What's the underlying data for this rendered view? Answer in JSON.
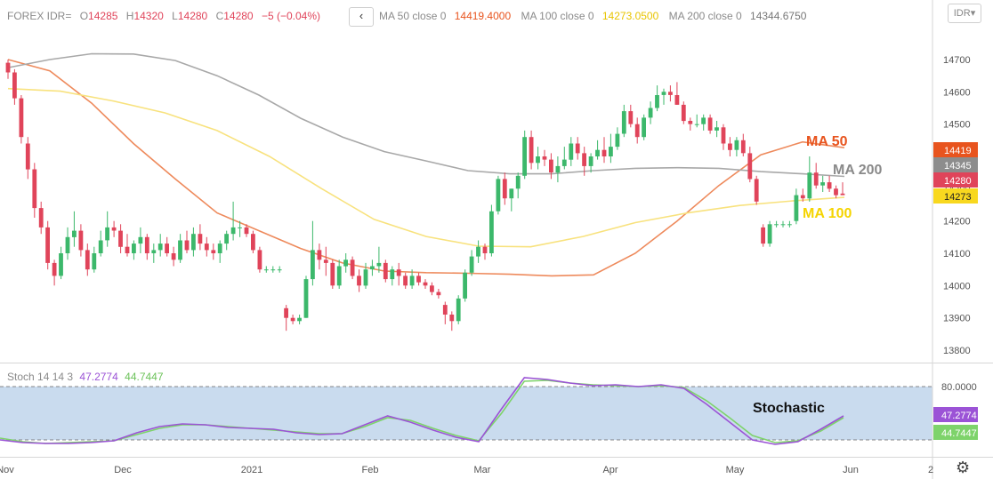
{
  "header": {
    "symbol": "FOREX IDR=",
    "o_label": "O",
    "o_value": "14285",
    "h_label": "H",
    "h_value": "14320",
    "l_label": "L",
    "l_value": "14280",
    "c_label": "C",
    "c_value": "14280",
    "change": "−5 (−0.04%)",
    "collapse_glyph": "‹",
    "ma50_label": "MA 50 close 0",
    "ma50_value": "14419.4000",
    "ma100_label": "MA 100 close 0",
    "ma100_value": "14273.0500",
    "ma200_label": "MA 200 close 0",
    "ma200_value": "14344.6750",
    "currency_button": "IDR"
  },
  "stoch_header": {
    "label": "Stoch 14 14 3",
    "k_value": "47.2774",
    "d_value": "44.7447"
  },
  "colors": {
    "up": "#3cb86b",
    "down": "#e0445a",
    "ma50": "#ee8a5c",
    "ma100": "#f8e27e",
    "ma200": "#a8a8a8",
    "stoch_k": "#9b53d6",
    "stoch_d": "#7ed36b",
    "stoch_band": "#c9dbee",
    "ma50_text": "#e8541e",
    "ma100_text": "#f5d400",
    "ma200_text": "#8a8a8a"
  },
  "icons": {
    "settings": "gear-icon",
    "collapse": "chevron-left-icon"
  },
  "chart_data": [
    {
      "type": "candlestick",
      "title": "FOREX IDR=",
      "y_ticks": [
        "14700",
        "14600",
        "14500",
        "14400",
        "14300",
        "14200",
        "14100",
        "14000",
        "13900",
        "13800"
      ],
      "x_ticks": [
        "Nov",
        "Dec",
        "2021",
        "Feb",
        "Mar",
        "Apr",
        "May",
        "Jun",
        "2"
      ],
      "ylim": [
        13760,
        14830
      ],
      "grid": false,
      "price_labels": [
        {
          "text": "14419",
          "value": 14419,
          "series": "MA 50"
        },
        {
          "text": "14345",
          "value": 14345,
          "series": "MA 200"
        },
        {
          "text": "14280",
          "value": 14280,
          "series": "Price"
        },
        {
          "text": "14273",
          "value": 14273,
          "series": "MA 100"
        }
      ],
      "annotations": [
        {
          "text": "MA 50",
          "series": "ma50"
        },
        {
          "text": "MA 200",
          "series": "ma200"
        },
        {
          "text": "MA 100",
          "series": "ma100"
        }
      ],
      "candles": [
        [
          14690,
          14700,
          14640,
          14660
        ],
        [
          14660,
          14670,
          14560,
          14580
        ],
        [
          14580,
          14590,
          14440,
          14460
        ],
        [
          14440,
          14460,
          14330,
          14360
        ],
        [
          14360,
          14380,
          14210,
          14240
        ],
        [
          14240,
          14260,
          14160,
          14180
        ],
        [
          14180,
          14200,
          14050,
          14070
        ],
        [
          14070,
          14080,
          14000,
          14030
        ],
        [
          14030,
          14120,
          14020,
          14100
        ],
        [
          14100,
          14180,
          14080,
          14150
        ],
        [
          14150,
          14230,
          14120,
          14170
        ],
        [
          14170,
          14190,
          14090,
          14110
        ],
        [
          14110,
          14130,
          14030,
          14050
        ],
        [
          14050,
          14120,
          14040,
          14100
        ],
        [
          14100,
          14170,
          14090,
          14140
        ],
        [
          14140,
          14230,
          14120,
          14180
        ],
        [
          14180,
          14200,
          14150,
          14170
        ],
        [
          14170,
          14190,
          14100,
          14120
        ],
        [
          14120,
          14160,
          14090,
          14100
        ],
        [
          14100,
          14140,
          14080,
          14130
        ],
        [
          14130,
          14180,
          14100,
          14150
        ],
        [
          14150,
          14160,
          14080,
          14100
        ],
        [
          14100,
          14130,
          14070,
          14110
        ],
        [
          14110,
          14160,
          14090,
          14130
        ],
        [
          14130,
          14150,
          14090,
          14100
        ],
        [
          14100,
          14120,
          14060,
          14080
        ],
        [
          14080,
          14160,
          14070,
          14140
        ],
        [
          14140,
          14170,
          14100,
          14110
        ],
        [
          14110,
          14180,
          14090,
          14160
        ],
        [
          14160,
          14190,
          14110,
          14130
        ],
        [
          14130,
          14150,
          14090,
          14110
        ],
        [
          14110,
          14130,
          14080,
          14100
        ],
        [
          14100,
          14140,
          14070,
          14130
        ],
        [
          14130,
          14170,
          14110,
          14160
        ],
        [
          14160,
          14260,
          14140,
          14180
        ],
        [
          14180,
          14200,
          14150,
          14180
        ],
        [
          14180,
          14190,
          14150,
          14160
        ],
        [
          14160,
          14170,
          14100,
          14110
        ],
        [
          14110,
          14120,
          14040,
          14050
        ],
        [
          14050,
          14060,
          14040,
          14050
        ],
        [
          14050,
          14060,
          14040,
          14050
        ],
        [
          14050,
          14060,
          14040,
          14050
        ],
        [
          13930,
          13940,
          13860,
          13900
        ],
        [
          13900,
          13910,
          13880,
          13890
        ],
        [
          13890,
          13910,
          13880,
          13900
        ],
        [
          13900,
          14030,
          13900,
          14020
        ],
        [
          14020,
          14200,
          14000,
          14110
        ],
        [
          14110,
          14130,
          14050,
          14080
        ],
        [
          14080,
          14120,
          14030,
          14070
        ],
        [
          14070,
          14080,
          13990,
          14000
        ],
        [
          14000,
          14080,
          13990,
          14060
        ],
        [
          14060,
          14100,
          14040,
          14080
        ],
        [
          14080,
          14090,
          14020,
          14030
        ],
        [
          14030,
          14050,
          13980,
          14000
        ],
        [
          14000,
          14070,
          13990,
          14050
        ],
        [
          14050,
          14080,
          14030,
          14060
        ],
        [
          14060,
          14120,
          14040,
          14070
        ],
        [
          14070,
          14080,
          14010,
          14020
        ],
        [
          14020,
          14060,
          14000,
          14050
        ],
        [
          14050,
          14070,
          14000,
          14030
        ],
        [
          14030,
          14040,
          13990,
          14000
        ],
        [
          14000,
          14050,
          13990,
          14030
        ],
        [
          14030,
          14040,
          14000,
          14010
        ],
        [
          14010,
          14020,
          13990,
          14000
        ],
        [
          14000,
          14010,
          13970,
          13980
        ],
        [
          13980,
          13990,
          13960,
          13970
        ],
        [
          13940,
          13950,
          13880,
          13910
        ],
        [
          13910,
          13920,
          13860,
          13890
        ],
        [
          13890,
          13970,
          13880,
          13960
        ],
        [
          13960,
          14050,
          13950,
          14040
        ],
        [
          14040,
          14110,
          14030,
          14090
        ],
        [
          14090,
          14140,
          14070,
          14120
        ],
        [
          14120,
          14130,
          14080,
          14100
        ],
        [
          14100,
          14250,
          14090,
          14230
        ],
        [
          14230,
          14340,
          14220,
          14330
        ],
        [
          14330,
          14350,
          14250,
          14270
        ],
        [
          14270,
          14300,
          14230,
          14300
        ],
        [
          14300,
          14350,
          14270,
          14340
        ],
        [
          14340,
          14480,
          14330,
          14460
        ],
        [
          14460,
          14480,
          14360,
          14380
        ],
        [
          14380,
          14430,
          14360,
          14400
        ],
        [
          14400,
          14420,
          14370,
          14390
        ],
        [
          14390,
          14410,
          14330,
          14350
        ],
        [
          14350,
          14400,
          14320,
          14370
        ],
        [
          14370,
          14430,
          14360,
          14390
        ],
        [
          14390,
          14460,
          14370,
          14440
        ],
        [
          14440,
          14460,
          14390,
          14410
        ],
        [
          14410,
          14430,
          14340,
          14370
        ],
        [
          14370,
          14410,
          14350,
          14400
        ],
        [
          14400,
          14450,
          14390,
          14420
        ],
        [
          14420,
          14460,
          14380,
          14400
        ],
        [
          14400,
          14470,
          14380,
          14430
        ],
        [
          14430,
          14490,
          14420,
          14470
        ],
        [
          14470,
          14560,
          14460,
          14540
        ],
        [
          14540,
          14560,
          14490,
          14500
        ],
        [
          14500,
          14520,
          14440,
          14460
        ],
        [
          14460,
          14530,
          14450,
          14520
        ],
        [
          14520,
          14570,
          14500,
          14550
        ],
        [
          14550,
          14620,
          14540,
          14590
        ],
        [
          14590,
          14610,
          14560,
          14600
        ],
        [
          14600,
          14620,
          14570,
          14590
        ],
        [
          14590,
          14630,
          14560,
          14560
        ],
        [
          14560,
          14570,
          14500,
          14510
        ],
        [
          14510,
          14520,
          14480,
          14500
        ],
        [
          14500,
          14530,
          14490,
          14500
        ],
        [
          14500,
          14530,
          14480,
          14520
        ],
        [
          14520,
          14530,
          14470,
          14480
        ],
        [
          14480,
          14510,
          14460,
          14490
        ],
        [
          14490,
          14500,
          14420,
          14440
        ],
        [
          14440,
          14460,
          14400,
          14420
        ],
        [
          14420,
          14460,
          14400,
          14450
        ],
        [
          14450,
          14470,
          14400,
          14410
        ],
        [
          14410,
          14430,
          14320,
          14330
        ],
        [
          14330,
          14340,
          14250,
          14260
        ],
        [
          14180,
          14190,
          14120,
          14130
        ],
        [
          14130,
          14200,
          14120,
          14190
        ],
        [
          14190,
          14200,
          14180,
          14190
        ],
        [
          14190,
          14200,
          14180,
          14190
        ],
        [
          14190,
          14200,
          14180,
          14190
        ],
        [
          14200,
          14300,
          14190,
          14280
        ],
        [
          14280,
          14300,
          14260,
          14270
        ],
        [
          14270,
          14400,
          14260,
          14350
        ],
        [
          14350,
          14380,
          14300,
          14310
        ],
        [
          14310,
          14340,
          14290,
          14320
        ],
        [
          14320,
          14340,
          14290,
          14300
        ],
        [
          14300,
          14310,
          14270,
          14280
        ],
        [
          14285,
          14320,
          14280,
          14280
        ]
      ],
      "series": [
        {
          "name": "MA 50 close 0",
          "key": "ma50",
          "values": [
            14700,
            14665,
            14565,
            14440,
            14330,
            14225,
            14170,
            14115,
            14070,
            14045,
            14040,
            14038,
            14035,
            14030,
            14033,
            14100,
            14200,
            14310,
            14405,
            14445,
            14427
          ]
        },
        {
          "name": "MA 100 close 0",
          "key": "ma100",
          "values": [
            14610,
            14602,
            14572,
            14535,
            14480,
            14400,
            14300,
            14205,
            14152,
            14122,
            14120,
            14152,
            14195,
            14225,
            14248,
            14262,
            14273
          ]
        },
        {
          "name": "MA 200 close 0",
          "key": "ma200",
          "values": [
            14675,
            14700,
            14718,
            14717,
            14697,
            14650,
            14590,
            14518,
            14460,
            14415,
            14386,
            14356,
            14346,
            14346,
            14356,
            14363,
            14365,
            14363,
            14353,
            14346,
            14338
          ]
        }
      ]
    },
    {
      "type": "line",
      "title": "Stoch 14 14 3",
      "y_ticks": [
        "80.0000"
      ],
      "ylim": [
        0,
        100
      ],
      "bands": [
        20,
        80
      ],
      "annotation": "Stochastic",
      "value_labels": [
        "47.2774",
        "44.7447"
      ],
      "series": [
        {
          "name": "Stoch 14 14 3",
          "key": "k",
          "values": [
            20,
            17,
            16,
            16,
            17,
            19,
            28,
            35,
            38,
            37,
            34,
            33,
            32,
            28,
            26,
            27,
            37,
            47,
            40,
            31,
            23,
            18,
            55,
            90,
            88,
            84,
            81,
            82,
            80,
            82,
            78,
            60,
            40,
            20,
            15,
            18,
            32,
            47
          ]
        },
        {
          "name": "",
          "key": "d",
          "values": [
            22,
            18,
            16,
            17,
            18,
            19,
            26,
            33,
            37,
            37,
            35,
            33,
            31,
            29,
            27,
            27,
            35,
            45,
            42,
            33,
            25,
            19,
            50,
            86,
            87,
            84,
            82,
            81,
            80,
            81,
            79,
            64,
            45,
            25,
            17,
            19,
            30,
            45
          ]
        }
      ]
    }
  ]
}
